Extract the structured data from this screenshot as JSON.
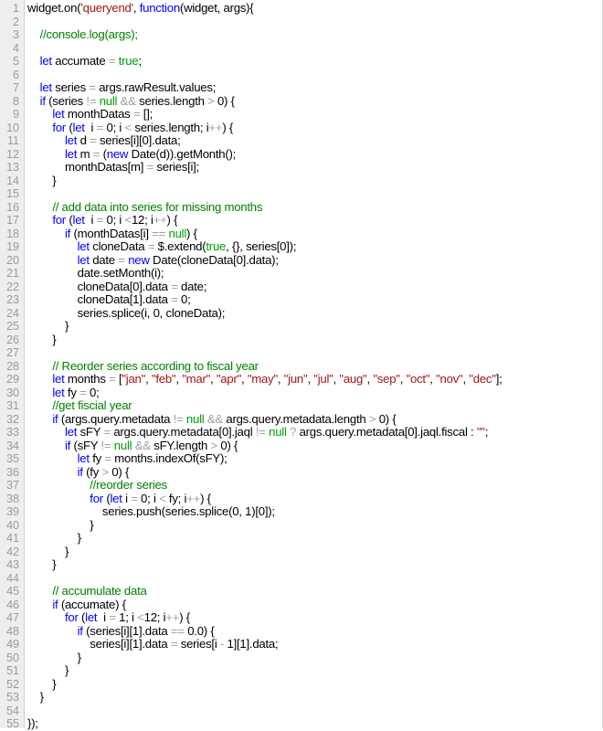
{
  "editor": {
    "lines": [
      [
        [
          "widget.on(",
          ""
        ],
        [
          "'queryend'",
          "s"
        ],
        [
          ", ",
          ""
        ],
        [
          "function",
          "k"
        ],
        [
          "(widget, args){",
          ""
        ]
      ],
      [],
      [
        [
          "    ",
          ""
        ],
        [
          "//console.log(args);",
          "c"
        ]
      ],
      [],
      [
        [
          "    ",
          ""
        ],
        [
          "let",
          "k"
        ],
        [
          " accumate ",
          ""
        ],
        [
          "=",
          "o"
        ],
        [
          " ",
          ""
        ],
        [
          "true",
          "l"
        ],
        [
          ";",
          ""
        ]
      ],
      [],
      [
        [
          "    ",
          ""
        ],
        [
          "let",
          "k"
        ],
        [
          " series ",
          ""
        ],
        [
          "=",
          "o"
        ],
        [
          " args.rawResult.values;",
          ""
        ]
      ],
      [
        [
          "    ",
          ""
        ],
        [
          "if",
          "k"
        ],
        [
          " (series ",
          ""
        ],
        [
          "!=",
          "o"
        ],
        [
          " ",
          ""
        ],
        [
          "null",
          "l"
        ],
        [
          " ",
          ""
        ],
        [
          "&&",
          "o"
        ],
        [
          " series.length ",
          ""
        ],
        [
          ">",
          "o"
        ],
        [
          " 0) {",
          ""
        ]
      ],
      [
        [
          "        ",
          ""
        ],
        [
          "let",
          "k"
        ],
        [
          " monthDatas ",
          ""
        ],
        [
          "=",
          "o"
        ],
        [
          " [];",
          ""
        ]
      ],
      [
        [
          "        ",
          ""
        ],
        [
          "for",
          "k"
        ],
        [
          " (",
          ""
        ],
        [
          "let",
          "k"
        ],
        [
          "  i ",
          ""
        ],
        [
          "=",
          "o"
        ],
        [
          " 0; i ",
          ""
        ],
        [
          "<",
          "o"
        ],
        [
          " series.length; i",
          ""
        ],
        [
          "++",
          "o"
        ],
        [
          ") {",
          ""
        ]
      ],
      [
        [
          "            ",
          ""
        ],
        [
          "let",
          "k"
        ],
        [
          " d ",
          ""
        ],
        [
          "=",
          "o"
        ],
        [
          " series[i][0].data;",
          ""
        ]
      ],
      [
        [
          "            ",
          ""
        ],
        [
          "let",
          "k"
        ],
        [
          " m ",
          ""
        ],
        [
          "=",
          "o"
        ],
        [
          " (",
          ""
        ],
        [
          "new",
          "k"
        ],
        [
          " Date(d)).getMonth();",
          ""
        ]
      ],
      [
        [
          "            monthDatas[m] ",
          ""
        ],
        [
          "=",
          "o"
        ],
        [
          " series[i];",
          ""
        ]
      ],
      [
        [
          "        }",
          ""
        ]
      ],
      [],
      [
        [
          "        ",
          ""
        ],
        [
          "// add data into series for missing months",
          "c"
        ]
      ],
      [
        [
          "        ",
          ""
        ],
        [
          "for",
          "k"
        ],
        [
          " (",
          ""
        ],
        [
          "let",
          "k"
        ],
        [
          "  i ",
          ""
        ],
        [
          "=",
          "o"
        ],
        [
          " 0; i ",
          ""
        ],
        [
          "<",
          "o"
        ],
        [
          "12; i",
          ""
        ],
        [
          "++",
          "o"
        ],
        [
          ") {",
          ""
        ]
      ],
      [
        [
          "            ",
          ""
        ],
        [
          "if",
          "k"
        ],
        [
          " (monthDatas[i] ",
          ""
        ],
        [
          "==",
          "o"
        ],
        [
          " ",
          ""
        ],
        [
          "null",
          "l"
        ],
        [
          ") {",
          ""
        ]
      ],
      [
        [
          "                ",
          ""
        ],
        [
          "let",
          "k"
        ],
        [
          " cloneData ",
          ""
        ],
        [
          "=",
          "o"
        ],
        [
          " $.extend(",
          ""
        ],
        [
          "true",
          "l"
        ],
        [
          ", {}, series[0]);",
          ""
        ]
      ],
      [
        [
          "                ",
          ""
        ],
        [
          "let",
          "k"
        ],
        [
          " date ",
          ""
        ],
        [
          "=",
          "o"
        ],
        [
          " ",
          ""
        ],
        [
          "new",
          "k"
        ],
        [
          " Date(cloneData[0].data);",
          ""
        ]
      ],
      [
        [
          "                date.setMonth(i);",
          ""
        ]
      ],
      [
        [
          "                cloneData[0].data ",
          ""
        ],
        [
          "=",
          "o"
        ],
        [
          " date;",
          ""
        ]
      ],
      [
        [
          "                cloneData[1].data ",
          ""
        ],
        [
          "=",
          "o"
        ],
        [
          " 0;",
          ""
        ]
      ],
      [
        [
          "                series.splice(i, 0, cloneData);",
          ""
        ]
      ],
      [
        [
          "            }",
          ""
        ]
      ],
      [
        [
          "        }",
          ""
        ]
      ],
      [],
      [
        [
          "        ",
          ""
        ],
        [
          "// Reorder series according to fiscal year",
          "c"
        ]
      ],
      [
        [
          "        ",
          ""
        ],
        [
          "let",
          "k"
        ],
        [
          " months ",
          ""
        ],
        [
          "=",
          "o"
        ],
        [
          " [",
          ""
        ],
        [
          "\"jan\"",
          "s"
        ],
        [
          ", ",
          ""
        ],
        [
          "\"feb\"",
          "s"
        ],
        [
          ", ",
          ""
        ],
        [
          "\"mar\"",
          "s"
        ],
        [
          ", ",
          ""
        ],
        [
          "\"apr\"",
          "s"
        ],
        [
          ", ",
          ""
        ],
        [
          "\"may\"",
          "s"
        ],
        [
          ", ",
          ""
        ],
        [
          "\"jun\"",
          "s"
        ],
        [
          ", ",
          ""
        ],
        [
          "\"jul\"",
          "s"
        ],
        [
          ", ",
          ""
        ],
        [
          "\"aug\"",
          "s"
        ],
        [
          ", ",
          ""
        ],
        [
          "\"sep\"",
          "s"
        ],
        [
          ", ",
          ""
        ],
        [
          "\"oct\"",
          "s"
        ],
        [
          ", ",
          ""
        ],
        [
          "\"nov\"",
          "s"
        ],
        [
          ", ",
          ""
        ],
        [
          "\"dec\"",
          "s"
        ],
        [
          "];",
          ""
        ]
      ],
      [
        [
          "        ",
          ""
        ],
        [
          "let",
          "k"
        ],
        [
          " fy ",
          ""
        ],
        [
          "=",
          "o"
        ],
        [
          " 0;",
          ""
        ]
      ],
      [
        [
          "        ",
          ""
        ],
        [
          "//get fiscial year",
          "c"
        ]
      ],
      [
        [
          "        ",
          ""
        ],
        [
          "if",
          "k"
        ],
        [
          " (args.query.metadata ",
          ""
        ],
        [
          "!=",
          "o"
        ],
        [
          " ",
          ""
        ],
        [
          "null",
          "l"
        ],
        [
          " ",
          ""
        ],
        [
          "&&",
          "o"
        ],
        [
          " args.query.metadata.length ",
          ""
        ],
        [
          ">",
          "o"
        ],
        [
          " 0) {",
          ""
        ]
      ],
      [
        [
          "            ",
          ""
        ],
        [
          "let",
          "k"
        ],
        [
          " sFY ",
          ""
        ],
        [
          "=",
          "o"
        ],
        [
          " args.query.metadata[0].jaql ",
          ""
        ],
        [
          "!=",
          "o"
        ],
        [
          " ",
          ""
        ],
        [
          "null",
          "l"
        ],
        [
          " ",
          ""
        ],
        [
          "?",
          "o"
        ],
        [
          " args.query.metadata[0].jaql.fiscal : ",
          ""
        ],
        [
          "\"\"",
          "s"
        ],
        [
          ";",
          ""
        ]
      ],
      [
        [
          "            ",
          ""
        ],
        [
          "if",
          "k"
        ],
        [
          " (sFY ",
          ""
        ],
        [
          "!=",
          "o"
        ],
        [
          " ",
          ""
        ],
        [
          "null",
          "l"
        ],
        [
          " ",
          ""
        ],
        [
          "&&",
          "o"
        ],
        [
          " sFY.length ",
          ""
        ],
        [
          ">",
          "o"
        ],
        [
          " 0) {",
          ""
        ]
      ],
      [
        [
          "                ",
          ""
        ],
        [
          "let",
          "k"
        ],
        [
          " fy ",
          ""
        ],
        [
          "=",
          "o"
        ],
        [
          " months.indexOf(sFY);",
          ""
        ]
      ],
      [
        [
          "                ",
          ""
        ],
        [
          "if",
          "k"
        ],
        [
          " (fy ",
          ""
        ],
        [
          ">",
          "o"
        ],
        [
          " 0) {",
          ""
        ]
      ],
      [
        [
          "                    ",
          ""
        ],
        [
          "//reorder series",
          "c"
        ]
      ],
      [
        [
          "                    ",
          ""
        ],
        [
          "for",
          "k"
        ],
        [
          " (",
          ""
        ],
        [
          "let",
          "k"
        ],
        [
          " i ",
          ""
        ],
        [
          "=",
          "o"
        ],
        [
          " 0; i ",
          ""
        ],
        [
          "<",
          "o"
        ],
        [
          " fy; i",
          ""
        ],
        [
          "++",
          "o"
        ],
        [
          ") {",
          ""
        ]
      ],
      [
        [
          "                        series.push(series.splice(0, 1)[0]);",
          ""
        ]
      ],
      [
        [
          "                    }",
          ""
        ]
      ],
      [
        [
          "                }",
          ""
        ]
      ],
      [
        [
          "            }",
          ""
        ]
      ],
      [
        [
          "        }",
          ""
        ]
      ],
      [],
      [
        [
          "        ",
          ""
        ],
        [
          "// accumulate data",
          "c"
        ]
      ],
      [
        [
          "        ",
          ""
        ],
        [
          "if",
          "k"
        ],
        [
          " (accumate) {",
          ""
        ]
      ],
      [
        [
          "            ",
          ""
        ],
        [
          "for",
          "k"
        ],
        [
          " (",
          ""
        ],
        [
          "let",
          "k"
        ],
        [
          "  i ",
          ""
        ],
        [
          "=",
          "o"
        ],
        [
          " 1; i ",
          ""
        ],
        [
          "<",
          "o"
        ],
        [
          "12; i",
          ""
        ],
        [
          "++",
          "o"
        ],
        [
          ") {",
          ""
        ]
      ],
      [
        [
          "                ",
          ""
        ],
        [
          "if",
          "k"
        ],
        [
          " (series[i][1].data ",
          ""
        ],
        [
          "==",
          "o"
        ],
        [
          " 0.0) {",
          ""
        ]
      ],
      [
        [
          "                    series[i][1].data ",
          ""
        ],
        [
          "=",
          "o"
        ],
        [
          " series[i ",
          ""
        ],
        [
          "-",
          "o"
        ],
        [
          " 1][1].data;",
          ""
        ]
      ],
      [
        [
          "                }",
          ""
        ]
      ],
      [
        [
          "            }",
          ""
        ]
      ],
      [
        [
          "        }",
          ""
        ]
      ],
      [
        [
          "    }",
          ""
        ]
      ],
      [],
      [
        [
          "});",
          ""
        ]
      ]
    ]
  }
}
